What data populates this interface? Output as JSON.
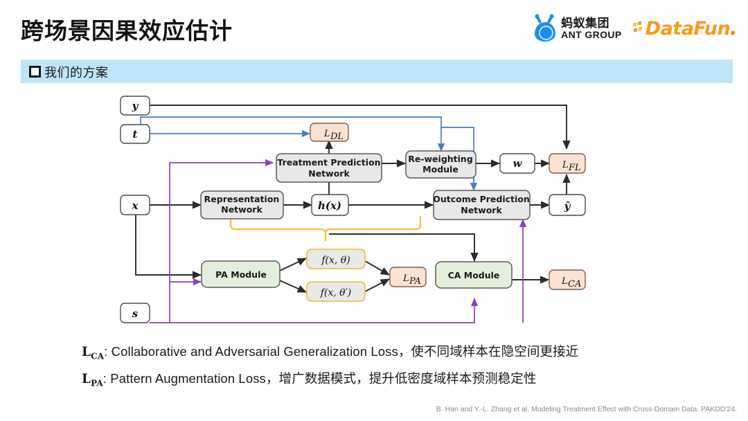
{
  "header": {
    "title": "跨场景因果效应估计",
    "logos": {
      "ant": {
        "cn": "蚂蚁集团",
        "en": "ANT GROUP",
        "icon": "ant-logo-icon",
        "color": "#1B8CEE"
      },
      "datafun": {
        "word_main": "DataFun",
        "word_dot": ".",
        "icon": "datafun-logo-icon",
        "color": "#F79A1E"
      }
    }
  },
  "section": {
    "marker": "square-bullet-icon",
    "label": "我们的方案",
    "band_color": "#BFE6F8"
  },
  "diagram": {
    "type": "architecture-flow-diagram",
    "colors": {
      "gray_box_fill": "#E8E8E8",
      "gray_box_stroke": "#5A5A5A",
      "white_box_fill": "#FFFFFF",
      "peach_box_fill": "#FBE2D2",
      "peach_box_stroke": "#8C6A56",
      "green_box_fill": "#E3EFDB",
      "green_box_stroke": "#5A5A5A",
      "yellow_box_stroke": "#F2C85B",
      "arrow_black": "#2B2B2B",
      "arrow_blue": "#4A7EBB",
      "arrow_purple": "#8A3FBF",
      "bracket_yellow": "#F2C04A"
    },
    "nodes": {
      "y": "y",
      "t": "t",
      "x": "x",
      "s": "s",
      "ldl": "L_DL",
      "ldl_base": "L",
      "ldl_sub": "DL",
      "treatment_prediction_network_l1": "Treatment Prediction",
      "treatment_prediction_network_l2": "Network",
      "reweighting_module_l1": "Re-weighting",
      "reweighting_module_l2": "Module",
      "w": "w",
      "lfl_base": "L",
      "lfl_sub": "FL",
      "representation_network_l1": "Representation",
      "representation_network_l2": "Network",
      "hx": "h(x)",
      "outcome_prediction_network_l1": "Outcome Prediction",
      "outcome_prediction_network_l2": "Network",
      "yhat": "ŷ",
      "pa_module": "PA Module",
      "f_theta": "f(x, θ)",
      "f_theta_prime": "f(x, θ′)",
      "lpa_base": "L",
      "lpa_sub": "PA",
      "ca_module": "CA Module",
      "lca_base": "L",
      "lca_sub": "CA"
    }
  },
  "captions": [
    {
      "symbol_base": "L",
      "symbol_sub": "CA",
      "text": ": Collaborative and Adversarial Generalization Loss，使不同域样本在隐空间更接近"
    },
    {
      "symbol_base": "L",
      "symbol_sub": "PA",
      "text": ": Pattern Augmentation Loss，增广数据模式，提升低密度域样本预测稳定性"
    }
  ],
  "citation": "B. Han and Y.-L. Zhang et al. Modeling Treatment Effect with Cross-Domain Data. PAKDD'24."
}
